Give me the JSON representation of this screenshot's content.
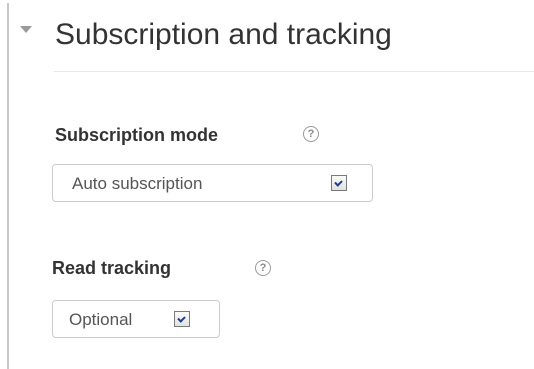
{
  "section": {
    "title": "Subscription and tracking",
    "toggle_icon": "collapse-triangle-icon"
  },
  "subscription_mode": {
    "label": "Subscription mode",
    "help_glyph": "?",
    "selected_value": "Auto subscription"
  },
  "read_tracking": {
    "label": "Read tracking",
    "help_glyph": "?",
    "selected_value": "Optional"
  },
  "colors": {
    "text": "#333333",
    "select_border": "#cccccc",
    "help_icon": "#9a9a9a",
    "dropdown_arrow": "#1d3f8a"
  }
}
